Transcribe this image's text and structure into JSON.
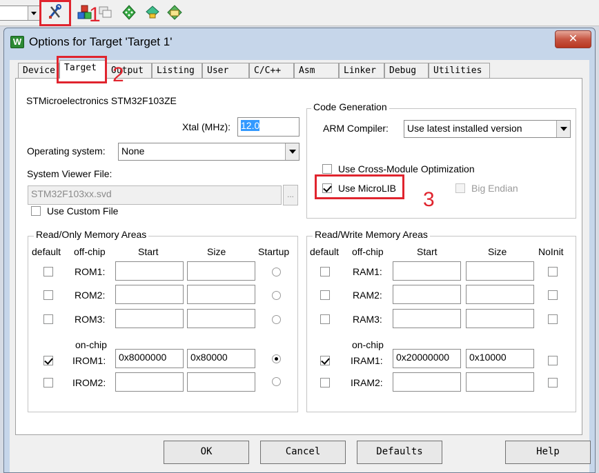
{
  "dialog": {
    "title": "Options for Target 'Target 1'",
    "icon_letter": "W",
    "close_glyph": "✕"
  },
  "tabs": [
    "Device",
    "Target",
    "Output",
    "Listing",
    "User",
    "C/C++",
    "Asm",
    "Linker",
    "Debug",
    "Utilities"
  ],
  "target": {
    "device_name": "STMicroelectronics STM32F103ZE",
    "xtal_label": "Xtal (MHz):",
    "xtal_value": "12.0",
    "os_label": "Operating system:",
    "os_value": "None",
    "svf_label": "System Viewer File:",
    "svf_value": "STM32F103xx.svd",
    "browse_label": "...",
    "custom_file_label": "Use Custom File"
  },
  "codegen": {
    "group_label": "Code Generation",
    "compiler_label": "ARM Compiler:",
    "compiler_value": "Use latest installed version",
    "cross_module_label": "Use Cross-Module Optimization",
    "microlib_label": "Use MicroLIB",
    "big_endian_label": "Big Endian"
  },
  "ro_memory": {
    "group_label": "Read/Only Memory Areas",
    "headers": [
      "default",
      "off-chip",
      "Start",
      "Size",
      "Startup"
    ],
    "on_chip_label": "on-chip",
    "rows": [
      {
        "name": "ROM1:",
        "start": "",
        "size": ""
      },
      {
        "name": "ROM2:",
        "start": "",
        "size": ""
      },
      {
        "name": "ROM3:",
        "start": "",
        "size": ""
      },
      {
        "name": "IROM1:",
        "start": "0x8000000",
        "size": "0x80000"
      },
      {
        "name": "IROM2:",
        "start": "",
        "size": ""
      }
    ]
  },
  "rw_memory": {
    "group_label": "Read/Write Memory Areas",
    "headers": [
      "default",
      "off-chip",
      "Start",
      "Size",
      "NoInit"
    ],
    "on_chip_label": "on-chip",
    "rows": [
      {
        "name": "RAM1:",
        "start": "",
        "size": ""
      },
      {
        "name": "RAM2:",
        "start": "",
        "size": ""
      },
      {
        "name": "RAM3:",
        "start": "",
        "size": ""
      },
      {
        "name": "IRAM1:",
        "start": "0x20000000",
        "size": "0x10000"
      },
      {
        "name": "IRAM2:",
        "start": "",
        "size": ""
      }
    ]
  },
  "buttons": {
    "ok": "OK",
    "cancel": "Cancel",
    "defaults": "Defaults",
    "help": "Help"
  },
  "annotations": {
    "step1": "1",
    "step2": "2",
    "step3": "3",
    "color": "#e0242e"
  },
  "toolbar": {
    "icons": [
      "target-options-icon",
      "manage-components-icon",
      "copy-windows-icon",
      "select-packs-icon",
      "pack-installer-icon",
      "book-icon"
    ]
  }
}
